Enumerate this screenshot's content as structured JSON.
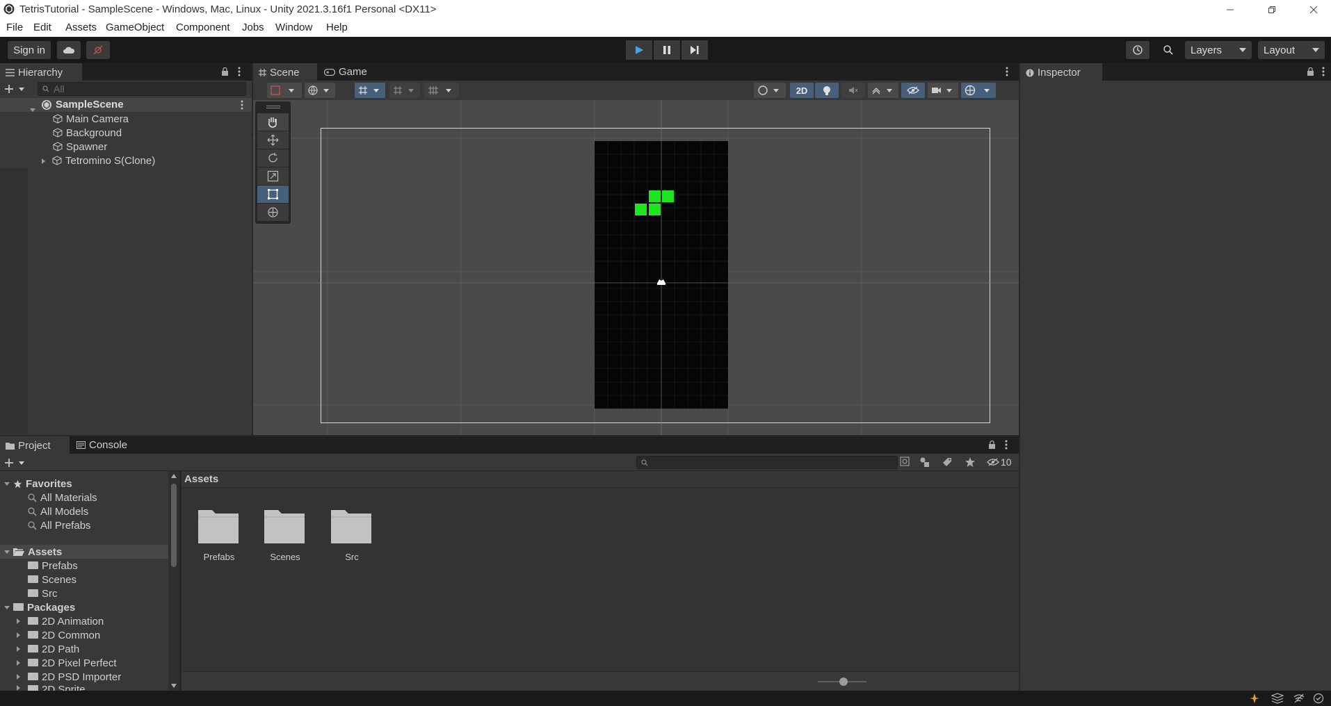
{
  "window": {
    "title": "TetrisTutorial - SampleScene - Windows, Mac, Linux - Unity 2021.3.16f1 Personal <DX11>"
  },
  "menu": [
    "File",
    "Edit",
    "Assets",
    "GameObject",
    "Component",
    "Jobs",
    "Window",
    "Help"
  ],
  "toolbar": {
    "sign_in": "Sign in",
    "layers": "Layers",
    "layout": "Layout"
  },
  "hierarchy": {
    "title": "Hierarchy",
    "search_placeholder": "All",
    "scene": "SampleScene",
    "items": [
      "Main Camera",
      "Background",
      "Spawner",
      "Tetromino S(Clone)"
    ]
  },
  "scene_view": {
    "tabs": [
      "Scene",
      "Game"
    ],
    "mode_2d": "2D"
  },
  "inspector": {
    "title": "Inspector"
  },
  "project": {
    "tabs": [
      "Project",
      "Console"
    ],
    "hidden_count": "10",
    "favorites": {
      "label": "Favorites",
      "items": [
        "All Materials",
        "All Models",
        "All Prefabs"
      ]
    },
    "assets": {
      "label": "Assets",
      "items": [
        "Prefabs",
        "Scenes",
        "Src"
      ]
    },
    "packages": {
      "label": "Packages",
      "items": [
        "2D Animation",
        "2D Common",
        "2D Path",
        "2D Pixel Perfect",
        "2D PSD Importer",
        "2D Sprite"
      ]
    },
    "breadcrumb": "Assets",
    "grid": [
      "Prefabs",
      "Scenes",
      "Src"
    ]
  },
  "colors": {
    "accent": "#46607c",
    "tetromino": "#1ee61e",
    "selected": "#2c5d87"
  }
}
